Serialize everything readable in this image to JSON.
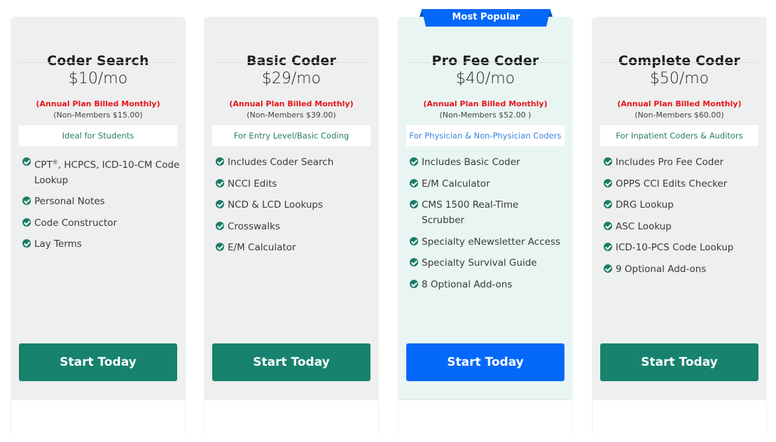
{
  "ribbon": {
    "label": "Most Popular",
    "color": "#0468fb"
  },
  "colors": {
    "green_accent": "#17826d",
    "blue_accent": "#0468fb",
    "billing_red": "#e8151b"
  },
  "plans": [
    {
      "title": "Coder Search",
      "price": "$10/mo",
      "billing": "(Annual Plan Billed Monthly)",
      "non_member": "(Non-Members $15.00)",
      "tagline": "Ideal for Students",
      "features": [
        {
          "text": "CPT®, HCPCS, ICD-10-CM Code Lookup"
        },
        {
          "text": "Personal Notes"
        },
        {
          "text": "Code Constructor"
        },
        {
          "text": "Lay Terms"
        }
      ],
      "cta": "Start Today"
    },
    {
      "title": "Basic Coder",
      "price": "$29/mo",
      "billing": "(Annual Plan Billed Monthly)",
      "non_member": "(Non-Members $39.00)",
      "tagline": "For Entry Level/Basic Coding",
      "features": [
        {
          "text": "Includes Coder Search"
        },
        {
          "text": "NCCI Edits"
        },
        {
          "text": "NCD & LCD Lookups"
        },
        {
          "text": "Crosswalks"
        },
        {
          "text": "E/M Calculator"
        }
      ],
      "cta": "Start Today"
    },
    {
      "title": "Pro Fee Coder",
      "price": "$40/mo",
      "billing": "(Annual Plan Billed Monthly)",
      "non_member": "(Non-Members $52.00 )",
      "tagline": "For Physician & Non-Physician Coders",
      "features": [
        {
          "text": "Includes Basic Coder"
        },
        {
          "text": "E/M Calculator"
        },
        {
          "text": "CMS 1500 Real-Time Scrubber"
        },
        {
          "text": "Specialty eNewsletter Access"
        },
        {
          "text": "Specialty Survival Guide"
        },
        {
          "text": "8 Optional Add-ons"
        }
      ],
      "cta": "Start Today"
    },
    {
      "title": "Complete Coder",
      "price": "$50/mo",
      "billing": "(Annual Plan Billed Monthly)",
      "non_member": "(Non-Members $60.00)",
      "tagline": "For Inpatient Coders & Auditors",
      "features": [
        {
          "text": "Includes Pro Fee Coder"
        },
        {
          "text": "OPPS CCI Edits Checker"
        },
        {
          "text": "DRG Lookup"
        },
        {
          "text": "ASC Lookup"
        },
        {
          "text": "ICD-10-PCS Code Lookup"
        },
        {
          "text": "9 Optional Add-ons"
        }
      ],
      "cta": "Start Today"
    }
  ]
}
